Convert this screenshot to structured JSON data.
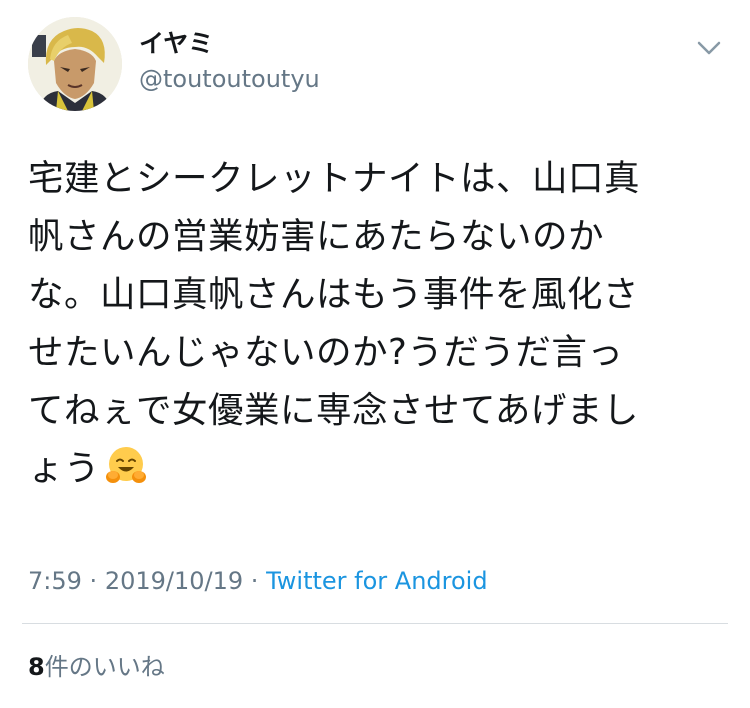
{
  "tweet": {
    "author": {
      "display_name": "イヤミ",
      "handle": "@toutoutoutyu",
      "avatar_icon": "avatar-icon"
    },
    "menu_icon": "chevron-down-icon",
    "text_lines": [
      "宅建とシークレットナイトは、山口真",
      "帆さんの営業妨害にあたらないのか",
      "な。山口真帆さんはもう事件を風化さ",
      "せたいんじゃないのか?うだうだ言っ",
      "てねぇで女優業に専念させてあげまし",
      "ょう"
    ],
    "emoji": "hugging-face-icon",
    "time": "7:59",
    "separator": "·",
    "date": "2019/10/19",
    "source": "Twitter for Android",
    "likes_count": "8",
    "likes_label": "件のいいね"
  },
  "colors": {
    "text": "#14171a",
    "secondary": "#657786",
    "link": "#1b95e0",
    "divider": "#d8dde1"
  }
}
